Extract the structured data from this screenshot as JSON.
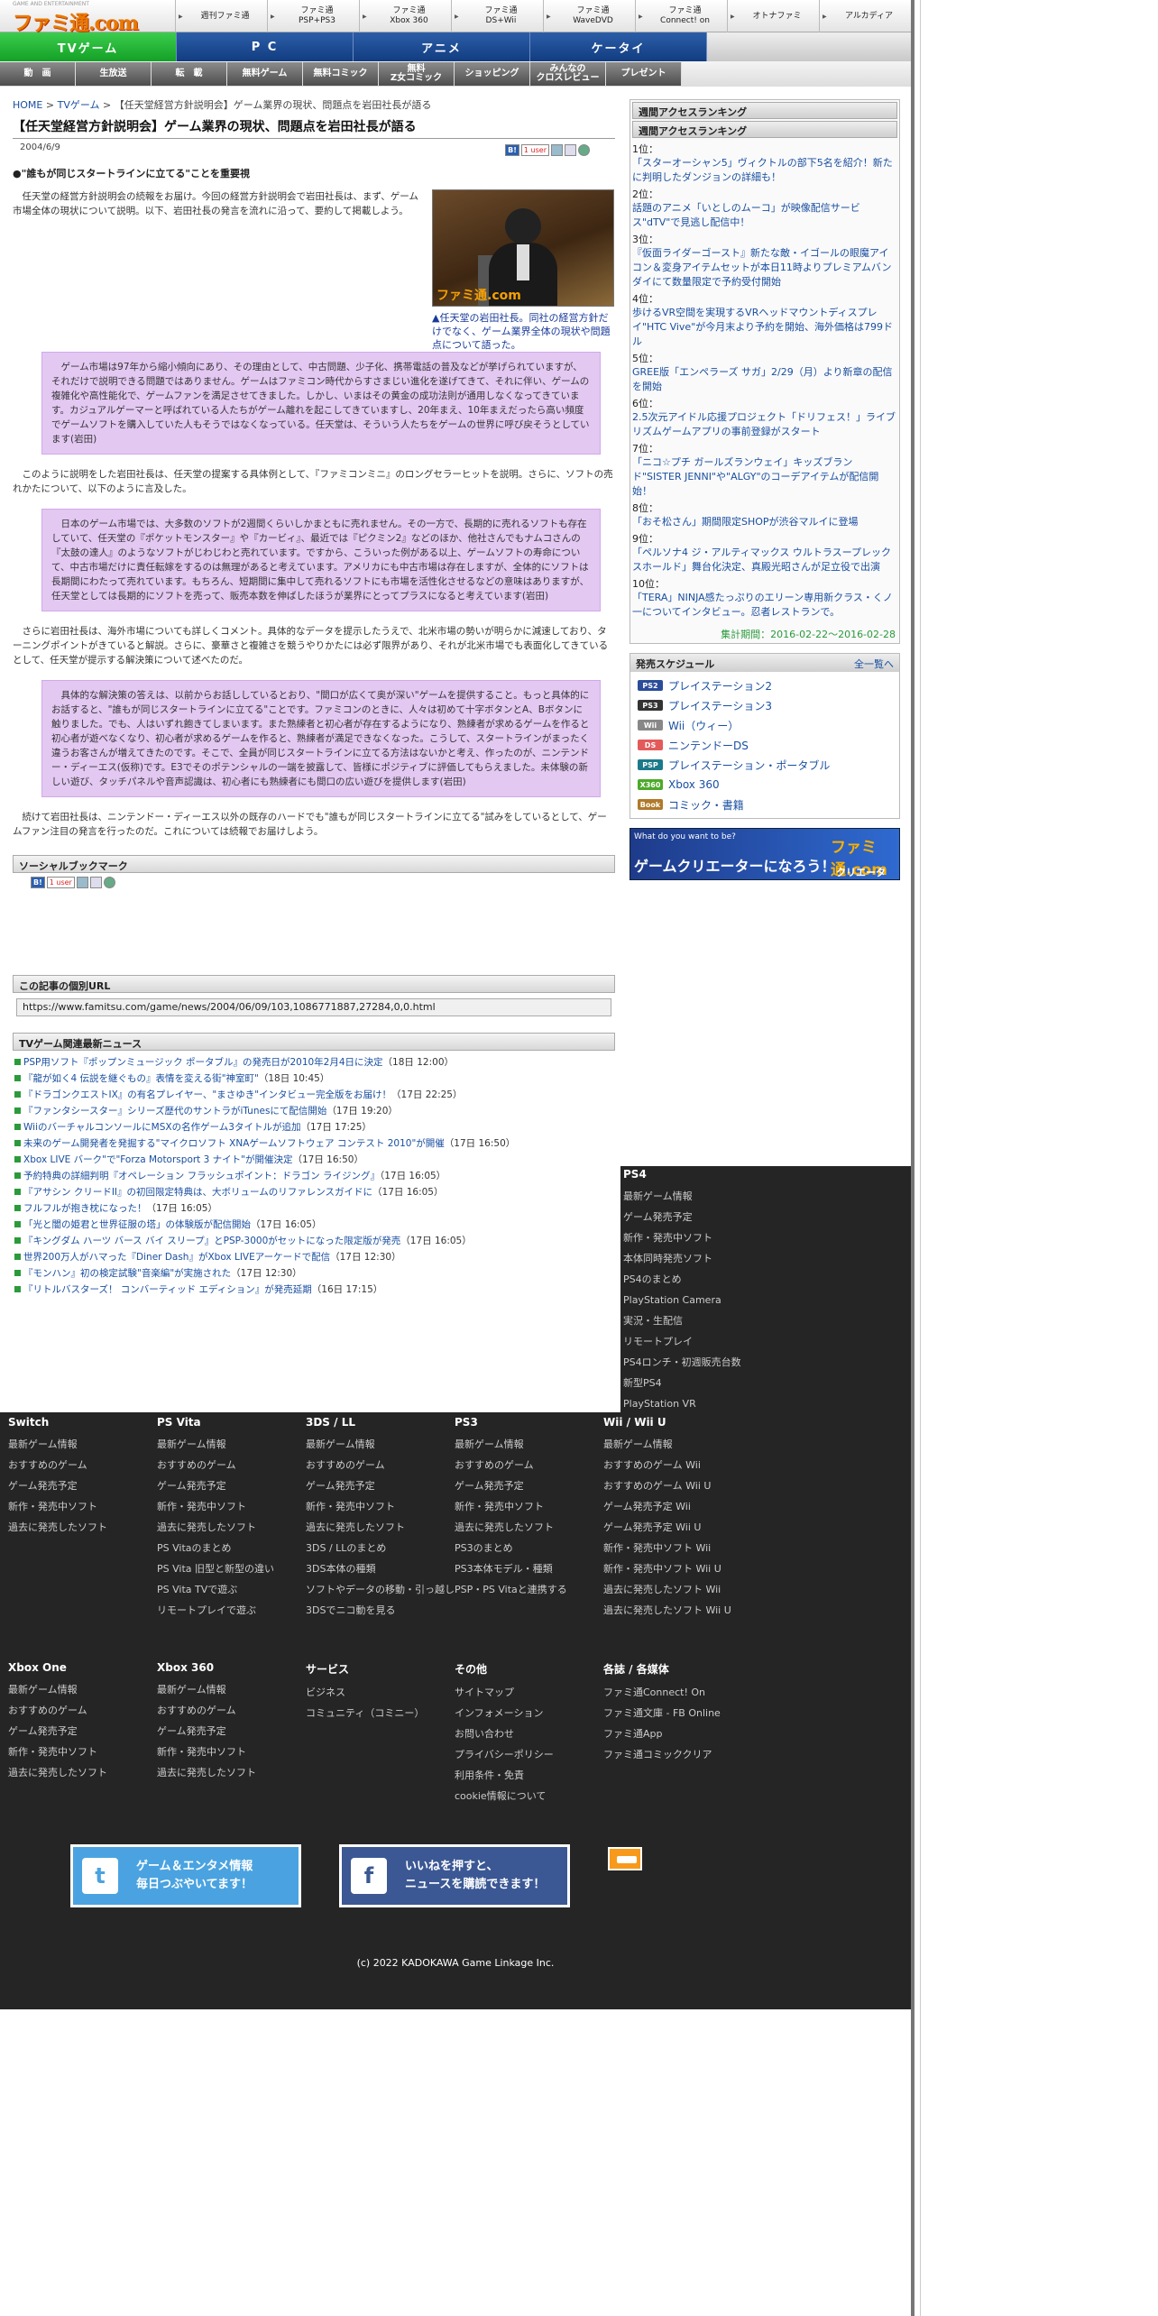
{
  "logo": {
    "small": "GAME AND ENTERTAINMENT",
    "big": "ファミ通.com"
  },
  "topnav": [
    {
      "label": "週刊ファミ通"
    },
    {
      "label": "ファミ通\nPSP+PS3"
    },
    {
      "label": "ファミ通\nXbox 360"
    },
    {
      "label": "ファミ通\nDS+Wii"
    },
    {
      "label": "ファミ通\nWaveDVD"
    },
    {
      "label": "ファミ通\nConnect! on"
    },
    {
      "label": "オトナファミ"
    },
    {
      "label": "アルカディア"
    }
  ],
  "categories": [
    "TVゲーム",
    "P C",
    "アニメ",
    "ケータイ"
  ],
  "subnav": [
    "動　画",
    "生放送",
    "転　載",
    "無料ゲーム",
    "無料コミック",
    "無料\nZ女コミック",
    "ショッピング",
    "みんなの\nクロスレビュー",
    "プレゼント"
  ],
  "breadcrumb": {
    "home": "HOME",
    "sep": " > ",
    "cat": "TVゲーム",
    "current": "【任天堂経営方針説明会】ゲーム業界の現状、問題点を岩田社長が語る"
  },
  "article": {
    "title": "【任天堂経営方針説明会】ゲーム業界の現状、問題点を岩田社長が語る",
    "date": "2004/6/9",
    "lead": "●\"誰もが同じスタートラインに立てる\"ことを重要視",
    "p1": "任天堂の経営方針説明会の続報をお届け。今回の経営方針説明会で岩田社長は、まず、ゲーム市場全体の現状について説明。以下、岩田社長の発言を流れに沿って、要約して掲載しよう。",
    "caption": "▲任天堂の岩田社長。同社の経営方針だけでなく、ゲーム業界全体の現状や問題点について語った。",
    "photo_watermark": "ファミ通.com",
    "q1": "ゲーム市場は97年から縮小傾向にあり、その理由として、中古問題、少子化、携帯電話の普及などが挙げられていますが、それだけで説明できる問題ではありません。ゲームはファミコン時代からすさまじい進化を遂げてきて、それに伴い、ゲームの複雑化や高性能化で、ゲームファンを満足させてきました。しかし、いまはその黄金の成功法則が通用しなくなってきています。カジュアルゲーマーと呼ばれている人たちがゲーム離れを起こしてきていますし、20年まえ、10年まえだったら高い頻度でゲームソフトを購入していた人もそうではなくなっている。任天堂は、そういう人たちをゲームの世界に呼び戻そうとしています(岩田)",
    "p2": "このように説明をした岩田社長は、任天堂の提案する具体例として、『ファミコンミニ』のロングセラーヒットを説明。さらに、ソフトの売れかたについて、以下のように言及した。",
    "q2": "日本のゲーム市場では、大多数のソフトが2週間くらいしかまともに売れません。その一方で、長期的に売れるソフトも存在していて、任天堂の『ポケットモンスター』や『カービィ』、最近では『ピクミン2』などのほか、他社さんでもナムコさんの『太鼓の達人』のようなソフトがじわじわと売れています。ですから、こういった例がある以上、ゲームソフトの寿命について、中古市場だけに責任転嫁をするのは無理があると考えています。アメリカにも中古市場は存在しますが、全体的にソフトは長期間にわたって売れています。もちろん、短期間に集中して売れるソフトにも市場を活性化させるなどの意味はありますが、任天堂としては長期的にソフトを売って、販売本数を伸ばしたほうが業界にとってプラスになると考えています(岩田)",
    "p3": "さらに岩田社長は、海外市場についても詳しくコメント。具体的なデータを提示したうえで、北米市場の勢いが明らかに減速しており、ターニングポイントがきていると解説。さらに、豪華さと複雑さを競うやりかたには必ず限界があり、それが北米市場でも表面化してきているとして、任天堂が提示する解決策について述べたのだ。",
    "q3": "具体的な解決策の答えは、以前からお話ししているとおり、\"間口が広くて奥が深い\"ゲームを提供すること。もっと具体的にお話すると、\"誰もが同じスタートラインに立てる\"ことです。ファミコンのときに、人々は初めて十字ボタンとA、Bボタンに触りました。でも、人はいずれ飽きてしまいます。また熟練者と初心者が存在するようになり、熟練者が求めるゲームを作ると初心者が遊べなくなり、初心者が求めるゲームを作ると、熟練者が満足できなくなった。こうして、スタートラインがまったく違うお客さんが増えてきたのです。そこで、全員が同じスタートラインに立てる方法はないかと考え、作ったのが、ニンテンドー・ディーエス(仮称)です。E3でそのポテンシャルの一端を披露して、皆様にポジティブに評価してもらえました。未体験の新しい遊び、タッチパネルや音声認識は、初心者にも熟練者にも間口の広い遊びを提供します(岩田)",
    "p4": "続けて岩田社長は、ニンテンドー・ディーエス以外の既存のハードでも\"誰もが同じスタートラインに立てる\"試みをしているとして、ゲームファン注目の発言を行ったのだ。これについては続報でお届けしよう。"
  },
  "social": {
    "heading": "ソーシャルブックマーク",
    "hatena": "B!",
    "user": "1 user"
  },
  "permalink": {
    "heading": "この記事の個別URL",
    "url": "https://www.famitsu.com/game/news/2004/06/09/103,1086771887,27284,0,0.html"
  },
  "news": {
    "heading": "TVゲーム関連最新ニュース",
    "items": [
      {
        "t": "PSP用ソフト『ポップンミュージック ポータブル』の発売日が2010年2月4日に決定",
        "d": "（18日 12:00）"
      },
      {
        "t": "『龍が如く4 伝説を継ぐもの』表情を変える街\"神室町\"",
        "d": "（18日 10:45）"
      },
      {
        "t": "『ドラゴンクエストIX』の有名プレイヤー、\"まさゆき\"インタビュー完全版をお届け！",
        "d": "（17日 22:25）"
      },
      {
        "t": "『ファンタシースター』シリーズ歴代のサントラがiTunesにて配信開始",
        "d": "（17日 19:20）"
      },
      {
        "t": "WiiのバーチャルコンソールにMSXの名作ゲーム3タイトルが追加",
        "d": "（17日 17:25）"
      },
      {
        "t": "未来のゲーム開発者を発掘する\"マイクロソフト XNAゲームソフトウェア コンテスト 2010\"が開催",
        "d": "（17日 16:50）"
      },
      {
        "t": "Xbox LIVE バーク\"で\"Forza Motorsport 3 ナイト\"が開催決定",
        "d": "（17日 16:50）"
      },
      {
        "t": "予約特典の詳細判明『オペレーション フラッシュポイント：ドラゴン ライジング』",
        "d": "（17日 16:05）"
      },
      {
        "t": "『アサシン クリードII』の初回限定特典は、大ボリュームのリファレンスガイドに",
        "d": "（17日 16:05）"
      },
      {
        "t": "フルフルが抱き枕になった！",
        "d": "（17日 16:05）"
      },
      {
        "t": "「光と闇の姫君と世界征服の塔」の体験版が配信開始",
        "d": "（17日 16:05）"
      },
      {
        "t": "『キングダム ハーツ バース バイ スリープ』とPSP-3000がセットになった限定版が発売",
        "d": "（17日 16:05）"
      },
      {
        "t": "世界200万人がハマった『Diner Dash』がXbox LIVEアーケードで配信",
        "d": "（17日 12:30）"
      },
      {
        "t": "『モンハン』初の検定試験\"音楽編\"が実施された",
        "d": "（17日 12:30）"
      },
      {
        "t": "『リトルバスターズ！ コンバーティッド エディション』が発売延期",
        "d": "（16日 17:15）"
      }
    ]
  },
  "ranking": {
    "title_outer": "週間アクセスランキング",
    "title_inner": "週間アクセスランキング",
    "items": [
      {
        "no": "1位：",
        "t": "「スターオーシャン5」ヴィクトルの部下5名を紹介！新たに判明したダンジョンの詳細も！"
      },
      {
        "no": "2位：",
        "t": "話題のアニメ「いとしのムーコ」が映像配信サービス\"dTV\"で見逃し配信中！"
      },
      {
        "no": "3位：",
        "t": "『仮面ライダーゴースト』新たな敵・イゴールの眼魔アイコン＆変身アイテムセットが本日11時よりプレミアムバンダイにて数量限定で予約受付開始"
      },
      {
        "no": "4位：",
        "t": "歩けるVR空間を実現するVRヘッドマウントディスプレイ\"HTC Vive\"が今月末より予約を開始、海外価格は799ドル"
      },
      {
        "no": "5位：",
        "t": "GREE版「エンペラーズ サガ」2/29（月）より新章の配信を開始"
      },
      {
        "no": "6位：",
        "t": "2.5次元アイドル応援プロジェクト「ドリフェス！」ライブリズムゲームアプリの事前登録がスタート"
      },
      {
        "no": "7位：",
        "t": "「ニコ☆プチ ガールズランウェイ」キッズブランド\"SISTER JENNI\"や\"ALGY\"のコーデアイテムが配信開始！"
      },
      {
        "no": "8位：",
        "t": "「おそ松さん」期間限定SHOPが渋谷マルイに登場"
      },
      {
        "no": "9位：",
        "t": "「ペルソナ4 ジ・アルティマックス ウルトラスープレックスホールド」舞台化決定、真殿光昭さんが足立役で出演"
      },
      {
        "no": "10位：",
        "t": "「TERA」NINJA感たっぷりのエリーン専用新クラス・くノ一についてインタビュー。忍者レストランで。"
      }
    ],
    "period": "集計期間：2016-02-22～2016-02-28"
  },
  "schedule": {
    "heading": "発売スケジュール",
    "all_link": "全一覧へ",
    "items": [
      {
        "badge": "PS2",
        "color": "#2b4c9a",
        "label": "プレイステーション2"
      },
      {
        "badge": "PS3",
        "color": "#333333",
        "label": "プレイステーション3"
      },
      {
        "badge": "Wii",
        "color": "#888888",
        "label": "Wii（ウィー）"
      },
      {
        "badge": "DS",
        "color": "#e45a5a",
        "label": "ニンテンドーDS"
      },
      {
        "badge": "PSP",
        "color": "#1b7a8a",
        "label": "プレイステーション・ポータブル"
      },
      {
        "badge": "X360",
        "color": "#4caa2a",
        "label": "Xbox 360"
      },
      {
        "badge": "Book",
        "color": "#b07a2a",
        "label": "コミック・書籍"
      }
    ]
  },
  "banner": {
    "t1": "What do you want to be?",
    "t2": "ゲームクリエーターになろう！",
    "logo": "ファミ通.com",
    "t3": "クリエータ"
  },
  "ps4": {
    "heading": "PS4",
    "items": [
      "最新ゲーム情報",
      "ゲーム発売予定",
      "新作・発売中ソフト",
      "本体同時発売ソフト",
      "PS4のまとめ",
      "PlayStation Camera",
      "実況・生配信",
      "リモートプレイ",
      "PS4ロンチ・初週販売台数",
      "新型PS4",
      "PlayStation VR"
    ]
  },
  "footer": {
    "row1": [
      {
        "h": "Switch",
        "items": [
          "最新ゲーム情報",
          "おすすめのゲーム",
          "ゲーム発売予定",
          "新作・発売中ソフト",
          "過去に発売したソフト"
        ]
      },
      {
        "h": "PS Vita",
        "items": [
          "最新ゲーム情報",
          "おすすめのゲーム",
          "ゲーム発売予定",
          "新作・発売中ソフト",
          "過去に発売したソフト",
          "PS Vitaのまとめ",
          "PS Vita 旧型と新型の違い",
          "PS Vita TVで遊ぶ",
          "リモートプレイで遊ぶ"
        ]
      },
      {
        "h": "3DS / LL",
        "items": [
          "最新ゲーム情報",
          "おすすめのゲーム",
          "ゲーム発売予定",
          "新作・発売中ソフト",
          "過去に発売したソフト",
          "3DS / LLのまとめ",
          "3DS本体の種類",
          "ソフトやデータの移動・引っ越し",
          "3DSでニコ動を見る"
        ]
      },
      {
        "h": "PS3",
        "items": [
          "最新ゲーム情報",
          "おすすめのゲーム",
          "ゲーム発売予定",
          "新作・発売中ソフト",
          "過去に発売したソフト",
          "PS3のまとめ",
          "PS3本体モデル・種類",
          "PSP・PS Vitaと連携する"
        ]
      },
      {
        "h": "Wii / Wii U",
        "items": [
          "最新ゲーム情報",
          "おすすめのゲーム Wii",
          "おすすめのゲーム Wii U",
          "ゲーム発売予定 Wii",
          "ゲーム発売予定 Wii U",
          "新作・発売中ソフト Wii",
          "新作・発売中ソフト Wii U",
          "過去に発売したソフト Wii",
          "過去に発売したソフト Wii U"
        ]
      }
    ],
    "row2": [
      {
        "h": "Xbox One",
        "items": [
          "最新ゲーム情報",
          "おすすめのゲーム",
          "ゲーム発売予定",
          "新作・発売中ソフト",
          "過去に発売したソフト"
        ]
      },
      {
        "h": "Xbox 360",
        "items": [
          "最新ゲーム情報",
          "おすすめのゲーム",
          "ゲーム発売予定",
          "新作・発売中ソフト",
          "過去に発売したソフト"
        ]
      },
      {
        "h": "サービス",
        "items": [
          "ビジネス",
          "コミュニティ（コミニー）"
        ]
      },
      {
        "h": "その他",
        "items": [
          "サイトマップ",
          "インフォメーション",
          "お問い合わせ",
          "プライバシーポリシー",
          "利用条件・免責",
          "cookie情報について"
        ]
      },
      {
        "h": "各誌 / 各媒体",
        "items": [
          "ファミ通Connect! On",
          "ファミ通文庫 - FB Online",
          "ファミ通App",
          "ファミ通コミッククリア"
        ]
      }
    ],
    "twitter": {
      "line1": "ゲーム＆エンタメ情報",
      "line2": "毎日つぶやいてます！"
    },
    "facebook": {
      "line1": "いいねを押すと、",
      "line2": "ニュースを購読できます！"
    },
    "copyright": "(c) 2022 KADOKAWA Game Linkage Inc."
  }
}
